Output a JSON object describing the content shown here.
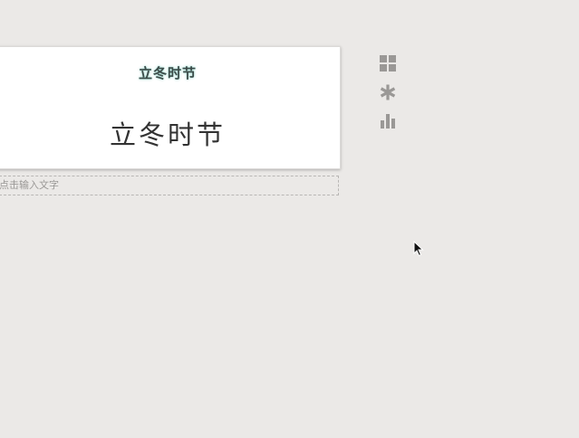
{
  "card": {
    "subtitle": "立冬时节",
    "title": "立冬时节"
  },
  "text_input": {
    "placeholder": "点击输入文字"
  },
  "toolbar": {
    "tools": [
      {
        "icon": "grid-icon"
      },
      {
        "icon": "asterisk-icon"
      },
      {
        "icon": "bar-chart-icon"
      }
    ]
  },
  "colors": {
    "background": "#ebe9e7",
    "icon": "#9a9896",
    "subtitle_glow": "#9fd8cf"
  }
}
